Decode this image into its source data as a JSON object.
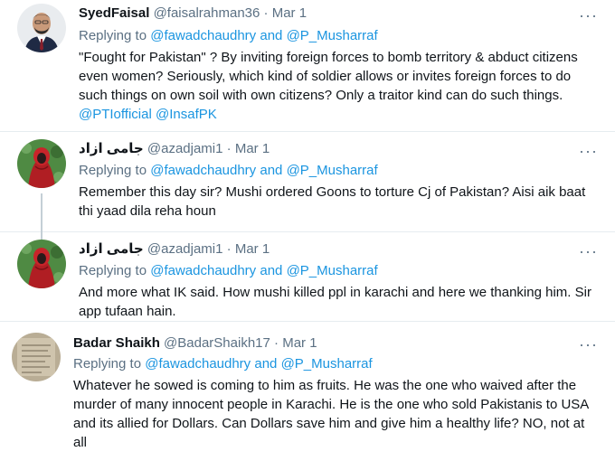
{
  "tweets": [
    {
      "name": "SyedFaisal",
      "handle": "@faisalrahman36",
      "dot": "·",
      "date": "Mar 1",
      "replying_prefix": "Replying to",
      "mention1": "@fawadchaudhry",
      "and": "and",
      "mention2": "@P_Musharraf",
      "text": "\"Fought for Pakistan\" ? By inviting foreign forces to bomb territory & abduct citizens even women? Seriously, which kind of soldier allows or invites foreign forces to do such things on own soil with own citizens? Only a traitor kind can do such things.",
      "text_mention1": "@PTIofficial",
      "text_mention2": "@InsafPK",
      "more": "···"
    },
    {
      "name": "جامی ازاد",
      "handle": "@azadjami1",
      "dot": "·",
      "date": "Mar 1",
      "replying_prefix": "Replying to",
      "mention1": "@fawadchaudhry",
      "and": "and",
      "mention2": "@P_Musharraf",
      "text": "Remember this day sir? Mushi ordered Goons to torture Cj of Pakistan? Aisi aik baat thi yaad dila reha houn",
      "more": "···"
    },
    {
      "name": "جامی ازاد",
      "handle": "@azadjami1",
      "dot": "·",
      "date": "Mar 1",
      "replying_prefix": "Replying to",
      "mention1": "@fawadchaudhry",
      "and": "and",
      "mention2": "@P_Musharraf",
      "text": "And more what IK said. How mushi killed ppl in karachi and here we thanking him. Sir app tufaan hain.",
      "more": "···"
    },
    {
      "name": "Badar Shaikh",
      "handle": "@BadarShaikh17",
      "dot": "·",
      "date": "Mar 1",
      "replying_prefix": "Replying to",
      "mention1": "@fawadchaudhry",
      "and": "and",
      "mention2": "@P_Musharraf",
      "text": "Whatever he sowed is coming to him as fruits. He was the one who waived after the murder of many innocent people in Karachi.  He is the one who sold Pakistanis to USA and its allied for Dollars. Can Dollars save him and give him a healthy life? NO, not at all",
      "more": "···"
    }
  ]
}
